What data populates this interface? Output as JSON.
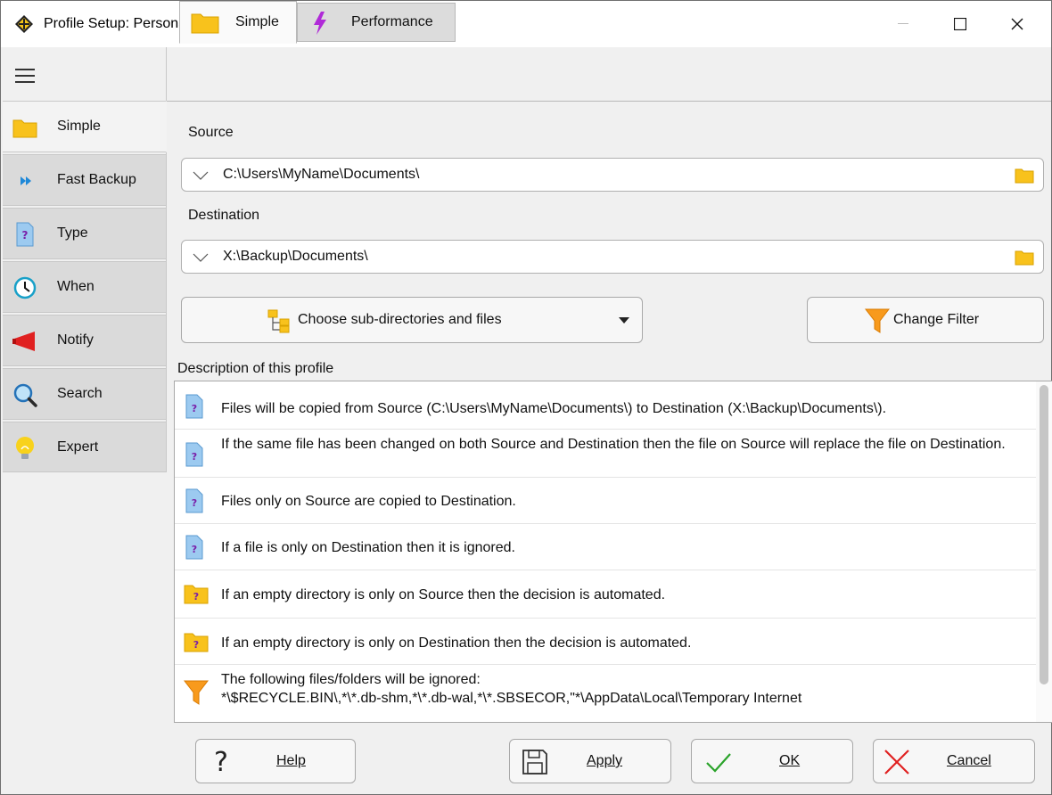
{
  "window": {
    "title": "Profile Setup: Personal Documents - Simple"
  },
  "sidebar": {
    "items": [
      {
        "label": "Simple",
        "icon": "folder-icon"
      },
      {
        "label": "Fast Backup",
        "icon": "fast-forward-icon"
      },
      {
        "label": "Type",
        "icon": "question-file-icon"
      },
      {
        "label": "When",
        "icon": "clock-icon"
      },
      {
        "label": "Notify",
        "icon": "megaphone-icon"
      },
      {
        "label": "Search",
        "icon": "magnifier-icon"
      },
      {
        "label": "Expert",
        "icon": "lightbulb-icon"
      }
    ]
  },
  "tabs": [
    {
      "label": "Simple",
      "icon": "folder-icon",
      "active": true
    },
    {
      "label": "Performance",
      "icon": "lightning-icon",
      "active": false
    }
  ],
  "source": {
    "label": "Source",
    "value": "C:\\Users\\MyName\\Documents\\"
  },
  "destination": {
    "label": "Destination",
    "value": "X:\\Backup\\Documents\\"
  },
  "choose_button": {
    "label": "Choose sub-directories and files"
  },
  "filter_button": {
    "label": "Change Filter"
  },
  "description": {
    "label": "Description of this profile",
    "rows": [
      {
        "icon": "question-file-icon",
        "text": "Files will be copied from Source (C:\\Users\\MyName\\Documents\\) to Destination (X:\\Backup\\Documents\\)."
      },
      {
        "icon": "question-file-icon",
        "text": "If the same file has been changed on both Source and Destination then the file on Source will replace the file on Destination."
      },
      {
        "icon": "question-file-icon",
        "text": "Files only on Source are copied to Destination."
      },
      {
        "icon": "question-file-icon",
        "text": "If a file is only on Destination then it is ignored."
      },
      {
        "icon": "question-folder-icon",
        "text": "If an empty directory is only on Source then the decision is automated."
      },
      {
        "icon": "question-folder-icon",
        "text": "If an empty directory is only on Destination then the decision is automated."
      },
      {
        "icon": "funnel-icon",
        "text": "The following files/folders will be ignored:",
        "text2": "*\\$RECYCLE.BIN\\,*\\*.db-shm,*\\*.db-wal,*\\*.SBSECOR,\"*\\AppData\\Local\\Temporary Internet"
      }
    ]
  },
  "buttons": {
    "help": "Help",
    "apply": "Apply",
    "ok": "OK",
    "cancel": "Cancel"
  },
  "colors": {
    "folder": "#f8c21c",
    "accent_blue": "#1e88d8",
    "cancel_red": "#e02020",
    "ok_green": "#2aa32a"
  }
}
